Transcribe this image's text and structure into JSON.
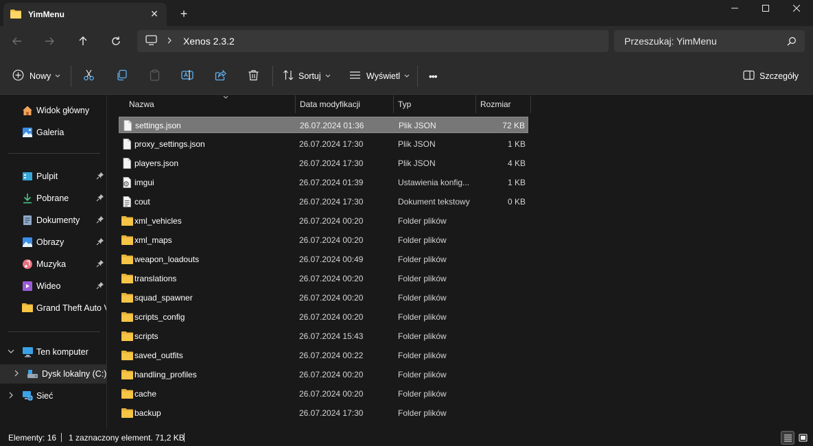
{
  "window": {
    "tab_title": "YimMenu",
    "tab_close": "✕",
    "new_tab": "+"
  },
  "nav": {
    "breadcrumb": [
      "Xenos 2.3.2"
    ],
    "search_placeholder": "Przeszukaj: YimMenu"
  },
  "commands": {
    "new": "Nowy",
    "sort": "Sortuj",
    "view": "Wyświetl",
    "more": "•••",
    "details": "Szczegóły"
  },
  "sidebar": {
    "top": [
      {
        "label": "Widok główny",
        "icon": "home-icon"
      },
      {
        "label": "Galeria",
        "icon": "gallery-icon"
      }
    ],
    "quick_access": [
      {
        "label": "Pulpit",
        "icon": "desktop-icon",
        "pinned": true
      },
      {
        "label": "Pobrane",
        "icon": "downloads-icon",
        "pinned": true
      },
      {
        "label": "Dokumenty",
        "icon": "documents-icon",
        "pinned": true
      },
      {
        "label": "Obrazy",
        "icon": "pictures-icon",
        "pinned": true
      },
      {
        "label": "Muzyka",
        "icon": "music-icon",
        "pinned": true
      },
      {
        "label": "Wideo",
        "icon": "video-icon",
        "pinned": true
      },
      {
        "label": "Grand Theft Auto V",
        "icon": "folder-icon",
        "pinned": false
      }
    ],
    "devices": [
      {
        "label": "Ten komputer",
        "icon": "this-pc-icon",
        "expanded": true
      },
      {
        "label": "Dysk lokalny (C:)",
        "icon": "local-disk-icon",
        "expanded": false,
        "selected": true
      },
      {
        "label": "Sieć",
        "icon": "network-icon",
        "expanded": false
      }
    ]
  },
  "columns": {
    "name": "Nazwa",
    "modified": "Data modyfikacji",
    "type": "Typ",
    "size": "Rozmiar"
  },
  "files": [
    {
      "name": "settings.json",
      "modified": "26.07.2024 01:36",
      "type": "Plik JSON",
      "size": "72 KB",
      "icon": "file-icon",
      "selected": true
    },
    {
      "name": "proxy_settings.json",
      "modified": "26.07.2024 17:30",
      "type": "Plik JSON",
      "size": "1 KB",
      "icon": "file-icon"
    },
    {
      "name": "players.json",
      "modified": "26.07.2024 17:30",
      "type": "Plik JSON",
      "size": "4 KB",
      "icon": "file-icon"
    },
    {
      "name": "imgui",
      "modified": "26.07.2024 01:39",
      "type": "Ustawienia konfig...",
      "size": "1 KB",
      "icon": "settings-file-icon"
    },
    {
      "name": "cout",
      "modified": "26.07.2024 17:30",
      "type": "Dokument tekstowy",
      "size": "0 KB",
      "icon": "text-file-icon"
    },
    {
      "name": "xml_vehicles",
      "modified": "26.07.2024 00:20",
      "type": "Folder plików",
      "size": "",
      "icon": "folder-icon"
    },
    {
      "name": "xml_maps",
      "modified": "26.07.2024 00:20",
      "type": "Folder plików",
      "size": "",
      "icon": "folder-icon"
    },
    {
      "name": "weapon_loadouts",
      "modified": "26.07.2024 00:49",
      "type": "Folder plików",
      "size": "",
      "icon": "folder-icon"
    },
    {
      "name": "translations",
      "modified": "26.07.2024 00:20",
      "type": "Folder plików",
      "size": "",
      "icon": "folder-icon"
    },
    {
      "name": "squad_spawner",
      "modified": "26.07.2024 00:20",
      "type": "Folder plików",
      "size": "",
      "icon": "folder-icon"
    },
    {
      "name": "scripts_config",
      "modified": "26.07.2024 00:20",
      "type": "Folder plików",
      "size": "",
      "icon": "folder-icon"
    },
    {
      "name": "scripts",
      "modified": "26.07.2024 15:43",
      "type": "Folder plików",
      "size": "",
      "icon": "folder-icon"
    },
    {
      "name": "saved_outfits",
      "modified": "26.07.2024 00:22",
      "type": "Folder plików",
      "size": "",
      "icon": "folder-icon"
    },
    {
      "name": "handling_profiles",
      "modified": "26.07.2024 00:20",
      "type": "Folder plików",
      "size": "",
      "icon": "folder-icon"
    },
    {
      "name": "cache",
      "modified": "26.07.2024 00:20",
      "type": "Folder plików",
      "size": "",
      "icon": "folder-icon"
    },
    {
      "name": "backup",
      "modified": "26.07.2024 17:30",
      "type": "Folder plików",
      "size": "",
      "icon": "folder-icon"
    }
  ],
  "status": {
    "count": "Elementy: 16",
    "selection": "1 zaznaczony element. 71,2 KB"
  },
  "colors": {
    "background": "#191919",
    "toolbar": "#2c2c2c",
    "selection": "#777777",
    "folder": "#f7c545"
  }
}
